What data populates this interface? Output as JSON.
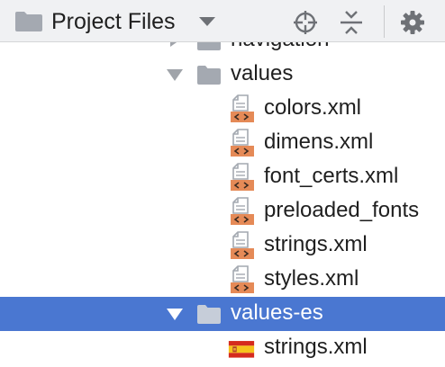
{
  "toolbar": {
    "title": "Project Files",
    "icons": {
      "folder": "folder-icon",
      "dropdown": "chevron-down-icon",
      "locate": "crosshair-icon",
      "collapse": "collapse-all-icon",
      "settings": "gear-icon"
    }
  },
  "tree": {
    "navigation_label": "navigation",
    "values_label": "values",
    "files": [
      {
        "name": "colors.xml"
      },
      {
        "name": "dimens.xml"
      },
      {
        "name": "font_certs.xml"
      },
      {
        "name": "preloaded_fonts"
      },
      {
        "name": "strings.xml"
      },
      {
        "name": "styles.xml"
      }
    ],
    "values_es_label": "values-es",
    "values_es_files": [
      {
        "name": "strings.xml"
      }
    ]
  },
  "colors": {
    "selection": "#4a77d1",
    "folder": "#a4a9b1",
    "xml_badge": "#e58a57",
    "toolbar_bg": "#f0f1f3"
  }
}
